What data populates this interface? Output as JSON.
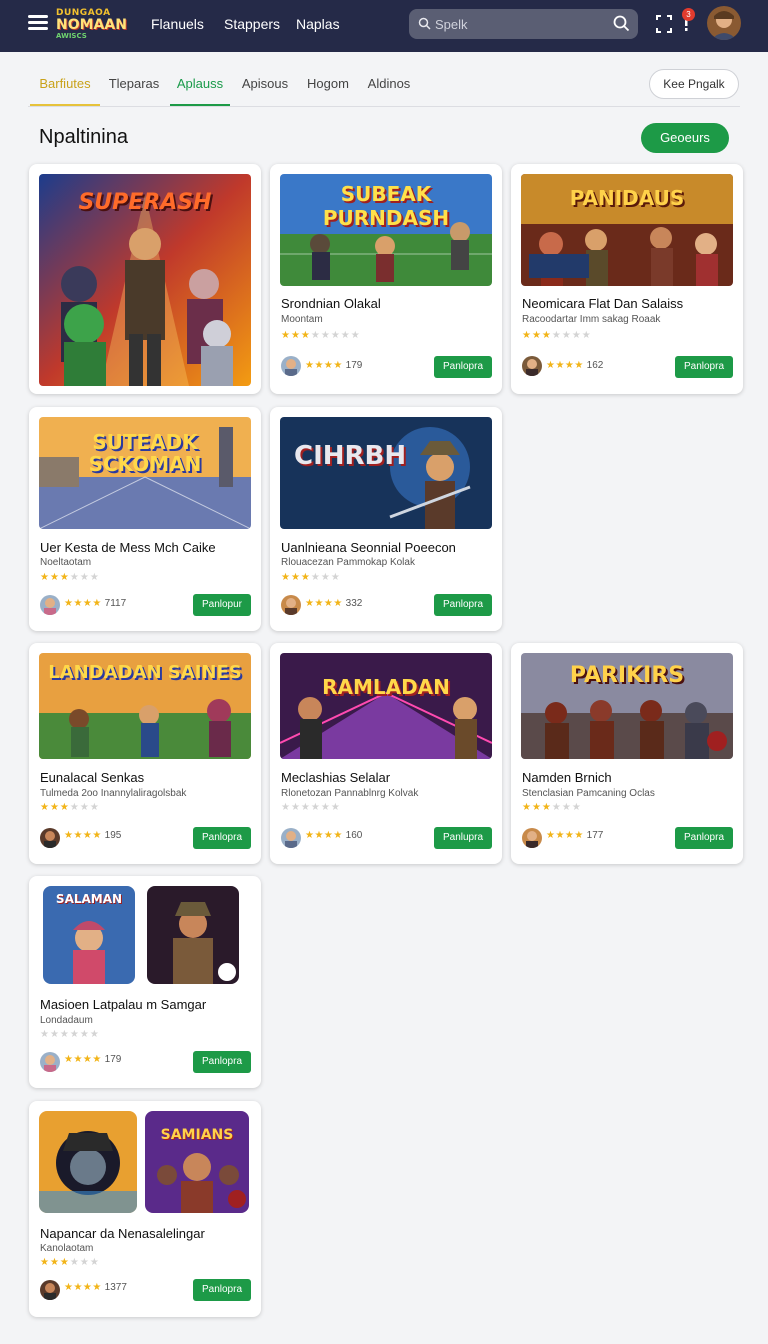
{
  "header": {
    "logo": {
      "line1": "DUNGAOA",
      "line2": "NOMAAN",
      "line3": "AWISCS"
    },
    "nav": [
      "Flanuels",
      "Stappers",
      "Naplas"
    ],
    "search_placeholder": "Spelk",
    "notification_count": "3"
  },
  "tabs": [
    "Barfiutes",
    "Tleparas",
    "Aplauss",
    "Apisous",
    "Hogom",
    "Aldinos"
  ],
  "active_tabs": [
    "Barfiutes",
    "Aplauss"
  ],
  "pill_button": "Kee Pngalk",
  "page_title": "Npaltinina",
  "primary_button": "Geoeurs",
  "cards": [
    {
      "art_title": "SUPERASH",
      "title": "",
      "subtitle": "",
      "stars": 0,
      "rating": "",
      "button": ""
    },
    {
      "art_title": "SUBEAK PURNDASH",
      "title": "Srondnian Olakal",
      "subtitle": "Moontam",
      "stars": 3,
      "rating": "179",
      "button": "Panlopra"
    },
    {
      "art_title": "PANIDAUS",
      "title": "Neomicara Flat Dan Salaiss",
      "subtitle": "Racoodartar Imm sakag Roaak",
      "stars": 3,
      "rating": "162",
      "button": "Panlopra"
    },
    {
      "art_title": "SUTEADK SCKOMAN",
      "title": "Uer Kesta de Mess Mch Caike",
      "subtitle": "Noeltaotam",
      "stars": 3,
      "rating": "7117",
      "button": "Panlopur"
    },
    {
      "art_title": "CIHRBH",
      "title": "Uanlnieana Seonnial Poeecon",
      "subtitle": "Rlouacezan Pammokap Kolak",
      "stars": 3,
      "rating": "332",
      "button": "Panlopra"
    },
    {
      "art_title": "LANDADAN SAINES",
      "title": "Eunalacal Senkas",
      "subtitle": "Tulmeda 2oo Inannylaliragolsbak",
      "stars": 3,
      "rating": "195",
      "button": "Panlopra"
    },
    {
      "art_title": "RAMLADAN",
      "title": "Meclashias Selalar",
      "subtitle": "Rlonetozan Pannablnrg Kolvak",
      "stars": 0,
      "rating": "160",
      "button": "Panlupra"
    },
    {
      "art_title": "PARIKIRS",
      "title": "Namden Brnich",
      "subtitle": "Stenclasian Pamcaning Oclas",
      "stars": 3,
      "rating": "177",
      "button": "Panlopra"
    },
    {
      "art_title": "SALAMAN",
      "title": "Masioen Latpalau m Samgar",
      "subtitle": "Londadaum",
      "stars": 0,
      "rating": "179",
      "button": "Panlopra"
    },
    {
      "art_title": "SAMIANS",
      "title": "Napancar da Nenasalelingar",
      "subtitle": "Kanolaotam",
      "stars": 3,
      "rating": "1377",
      "button": "Panlopra"
    }
  ],
  "colors": {
    "topbar": "#252a48",
    "accent_green": "#1d9a47",
    "tab_yellow": "#c9a21a",
    "star": "#f2b418"
  }
}
